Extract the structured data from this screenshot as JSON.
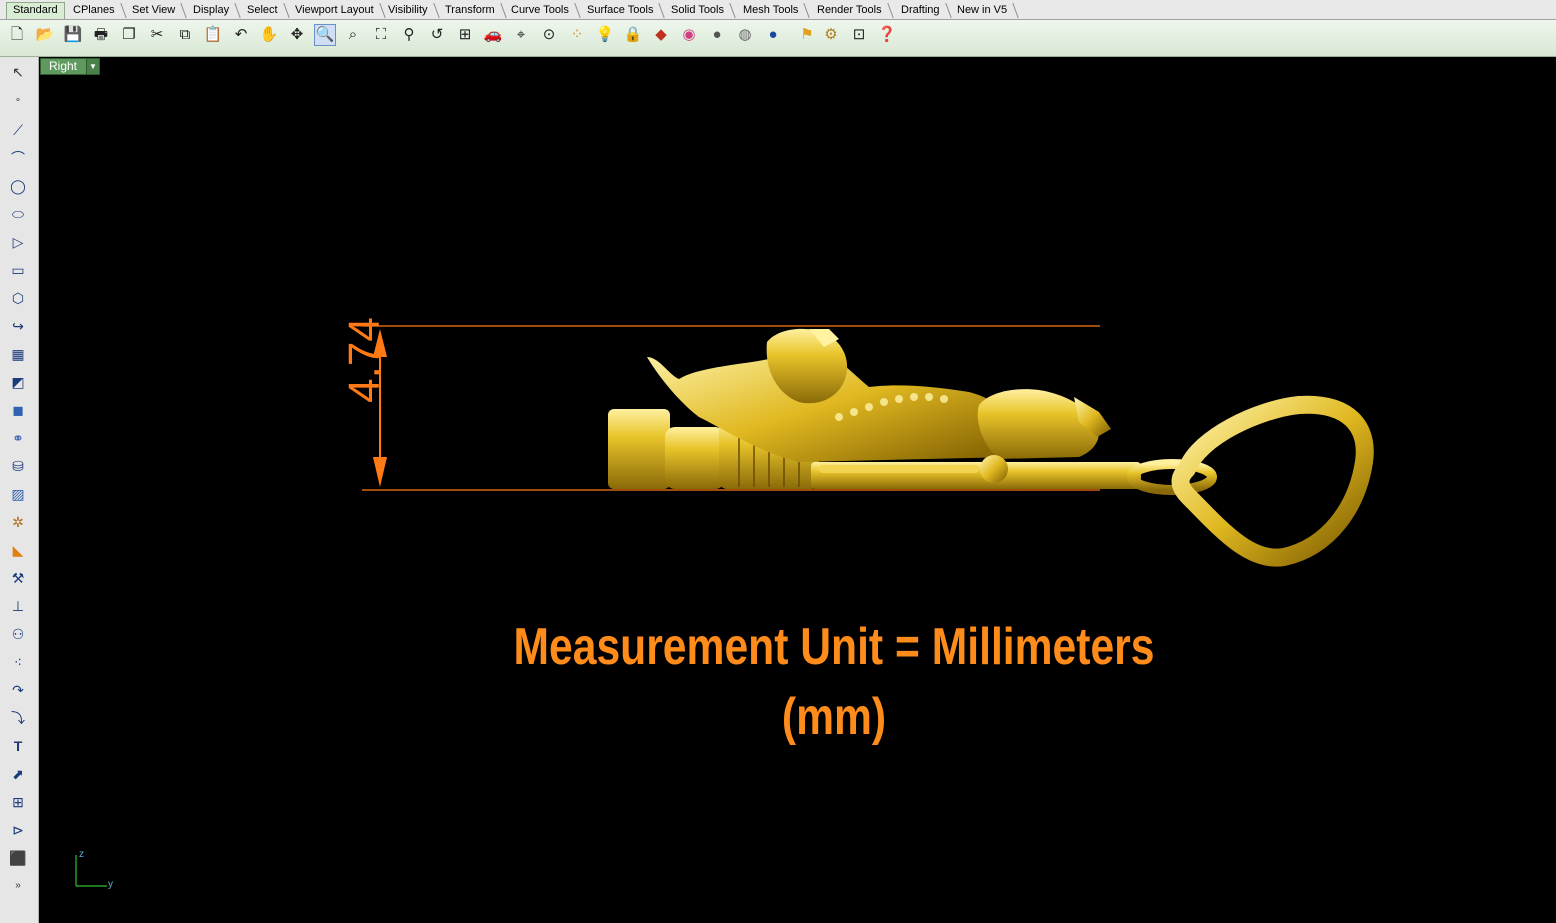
{
  "tabs": [
    "Standard",
    "CPlanes",
    "Set View",
    "Display",
    "Select",
    "Viewport Layout",
    "Visibility",
    "Transform",
    "Curve Tools",
    "Surface Tools",
    "Solid Tools",
    "Mesh Tools",
    "Render Tools",
    "Drafting",
    "New in V5"
  ],
  "toolbar_icons": [
    "new-icon",
    "open-icon",
    "save-icon",
    "print-icon",
    "import-icon",
    "cut-icon",
    "copy-icon",
    "paste-icon",
    "undo-icon",
    "pan-hand-icon",
    "rotate-view-icon",
    "zoom-dynamic-icon",
    "zoom-window-icon",
    "zoom-extents-icon",
    "zoom-selected-icon",
    "undo-view-icon",
    "four-viewports-icon",
    "car-icon",
    "osnap-icon",
    "grid-snap-icon",
    "points-icon",
    "light-icon",
    "lock-icon",
    "layer-icon",
    "color-wheel-icon",
    "shade-icon",
    "rendered-icon",
    "render-sphere-icon",
    "select-filter-icon",
    "options-icon",
    "dimension-icon",
    "help-icon"
  ],
  "left_icons": [
    "select-arrow-icon",
    "point-icon",
    "polyline-icon",
    "curve-icon",
    "circle-icon",
    "ellipse-icon",
    "polygon-icon",
    "rectangle-icon",
    "arc-icon",
    "fillet-icon",
    "surface-icon",
    "extrude-icon",
    "box-icon",
    "boolean-icon",
    "cylinder-icon",
    "mesh-icon",
    "transform-icon",
    "analyze-icon",
    "edit-points-icon",
    "join-icon",
    "group-icon",
    "solid-edit-icon",
    "curve-from-object-icon",
    "offset-icon",
    "text-icon",
    "snap-icon",
    "array-icon",
    "blocks-icon",
    "render-box-icon",
    "more-icon"
  ],
  "viewport": {
    "name": "Right"
  },
  "dimension": {
    "value": "4.74"
  },
  "caption": "Measurement Unit = Millimeters (mm)",
  "axis": {
    "z": "z",
    "y": "y"
  },
  "colors": {
    "dimension": "#ff7a14",
    "gold": "#e8c42a",
    "background": "#000000"
  }
}
